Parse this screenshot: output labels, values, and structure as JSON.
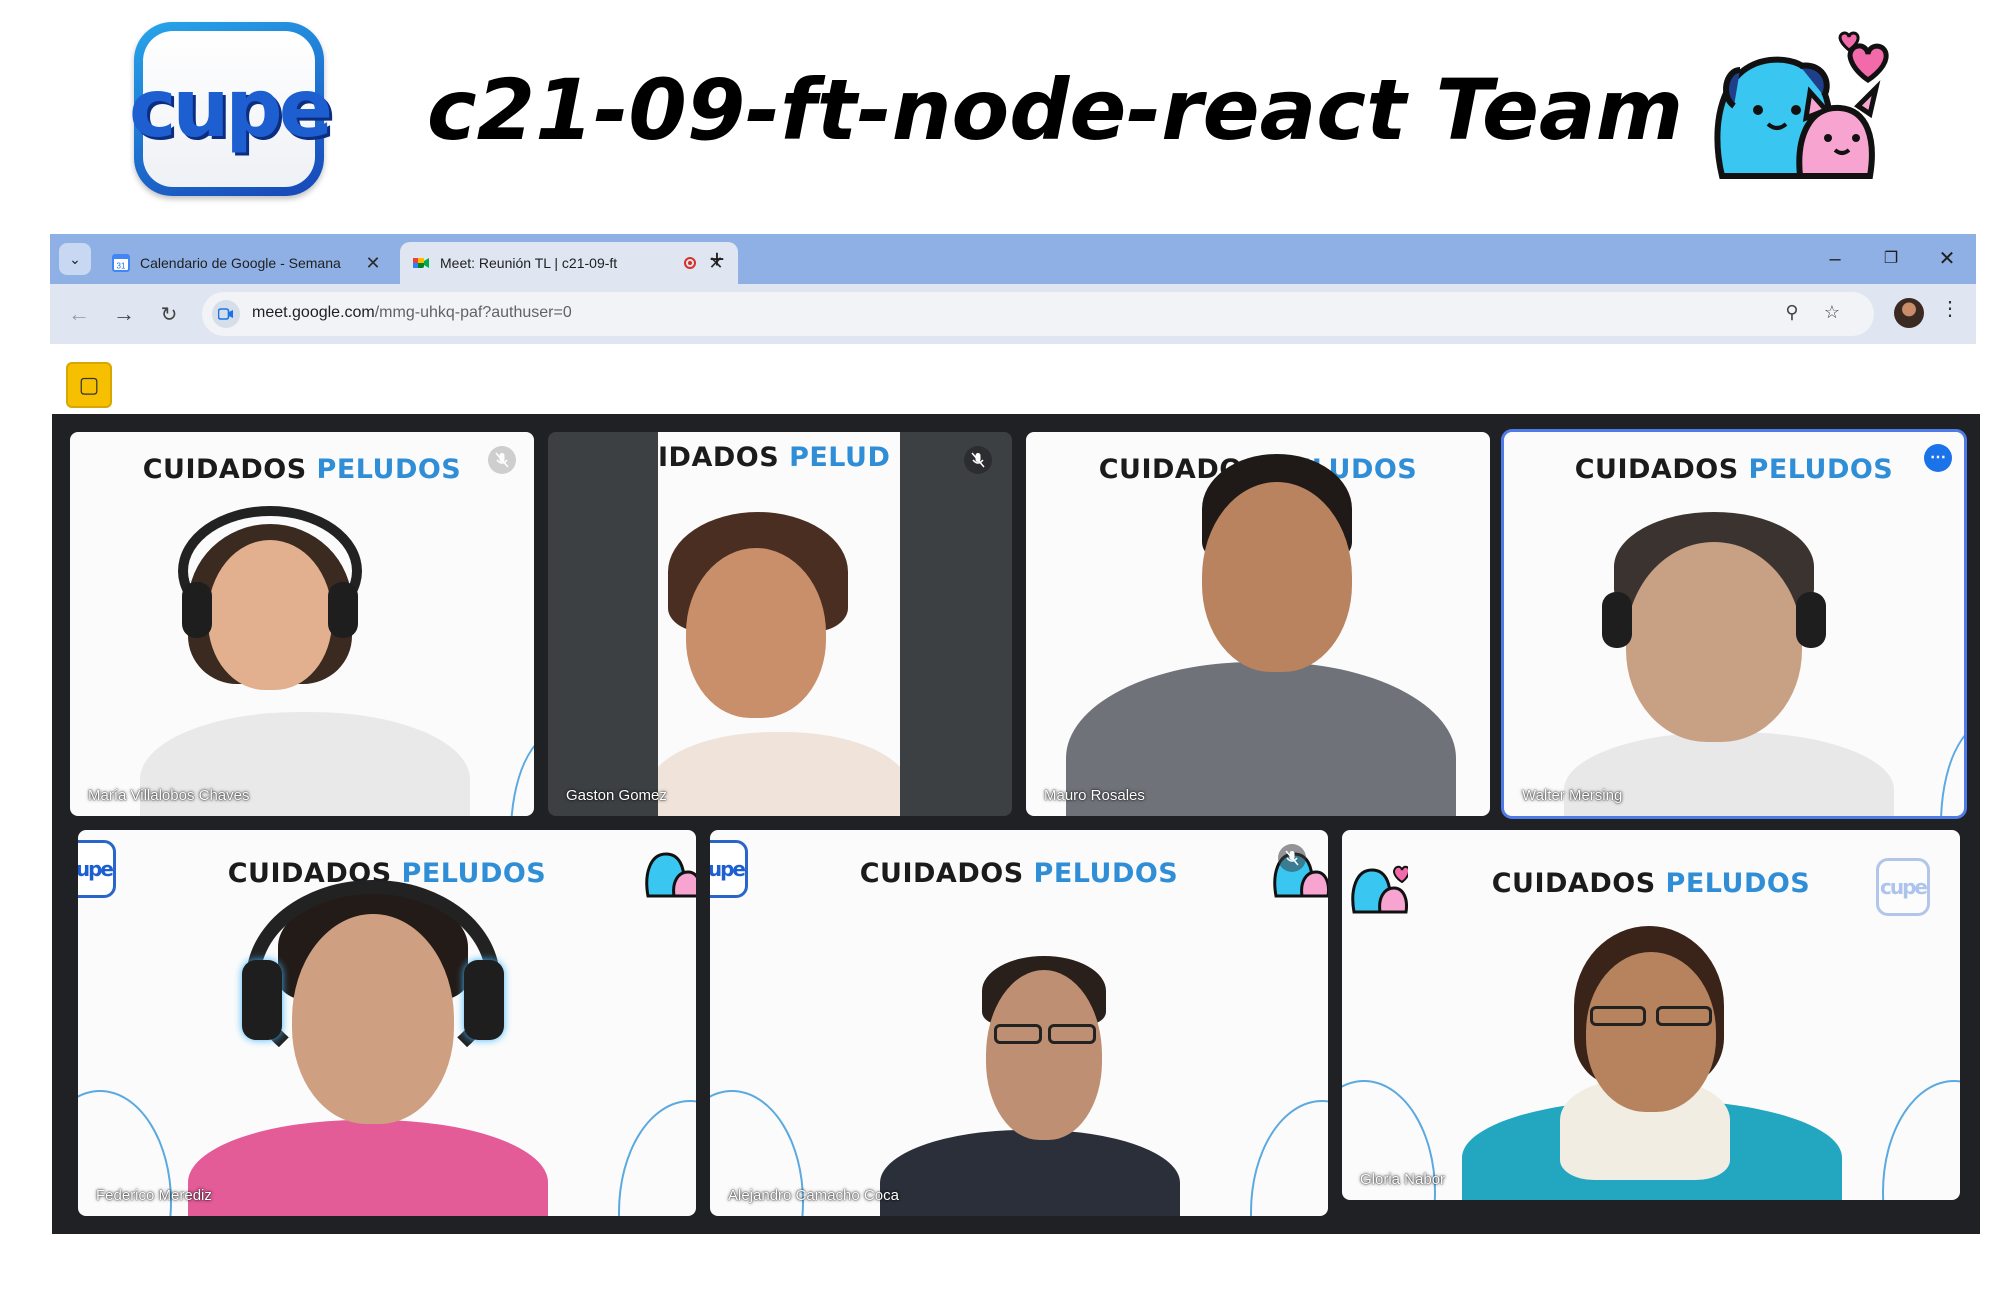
{
  "header": {
    "logo_text": "cupe",
    "title": "c21-09-ft-node-react Team"
  },
  "browser": {
    "tabs": [
      {
        "label": "Calendario de Google - Semana",
        "icon": "google-calendar-icon",
        "active": false
      },
      {
        "label": "Meet: Reunión TL | c21-09-ft",
        "icon": "google-meet-icon",
        "active": true,
        "recording": true
      }
    ],
    "url_host": "meet.google.com",
    "url_path": "/mmg-uhkq-paf?authuser=0",
    "calendar_day": "31"
  },
  "meet": {
    "banner_word_1": "CUIDADOS",
    "banner_word_2": "PELUDOS",
    "banner_cut": "IDADOS",
    "banner_cut_2": "PELUD",
    "participants": [
      {
        "name": "María Villalobos Chaves",
        "muted": true
      },
      {
        "name": "Gaston Gomez",
        "muted": true
      },
      {
        "name": "Mauro Rosales",
        "muted": false
      },
      {
        "name": "Walter Mersing",
        "muted": false,
        "speaking": true
      },
      {
        "name": "Federico Merediz",
        "muted": false
      },
      {
        "name": "Alejandro Camacho Coca",
        "muted": true
      },
      {
        "name": "Gloria Nabor",
        "muted": false
      }
    ],
    "colors": {
      "accent": "#1a73e8",
      "banner_blue": "#2f8ed6",
      "stage_bg": "#202124"
    }
  }
}
